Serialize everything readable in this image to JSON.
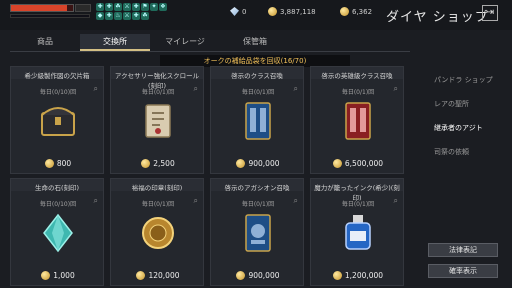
{
  "topbar": {
    "buffs": [
      "✚",
      "✚",
      "☘",
      "⚔",
      "✚",
      "⚑",
      "✦",
      "❖",
      "◆",
      "✚",
      "♨",
      "⚔",
      "✚",
      "☘"
    ],
    "diamond_count": "0",
    "silver_count": "3,887,118",
    "gold_count": "6,362",
    "shop_title": "ダイヤ ショップ",
    "exit_glyph": "⇥"
  },
  "tabs": [
    {
      "label": "商品",
      "active": false
    },
    {
      "label": "交換所",
      "active": true
    },
    {
      "label": "マイレージ",
      "active": false
    },
    {
      "label": "保管箱",
      "active": false
    }
  ],
  "banner": "オークの補給品袋を回収(16/70)",
  "items": [
    {
      "title": "希少級製作図の欠片箱",
      "limit": "毎日(0/10)回",
      "price": "800",
      "icon": "chest-icon"
    },
    {
      "title": "アクセサリー強化スクロール(刻印)",
      "limit": "毎日(0/1)回",
      "price": "2,500",
      "icon": "scroll-icon"
    },
    {
      "title": "啓示のクラス召喚",
      "limit": "毎日(0/1)回",
      "price": "900,000",
      "icon": "card-blue-icon"
    },
    {
      "title": "啓示の英雄級クラス召喚",
      "limit": "毎日(0/1)回",
      "price": "6,500,000",
      "icon": "card-red-icon"
    },
    {
      "title": "生命の石(刻印)",
      "limit": "毎日(0/10)回",
      "price": "1,000",
      "icon": "crystal-icon"
    },
    {
      "title": "裕福の印章(刻印)",
      "limit": "毎日(0/1)回",
      "price": "120,000",
      "icon": "seal-icon"
    },
    {
      "title": "啓示のアガシオン召喚",
      "limit": "毎日(0/1)回",
      "price": "900,000",
      "icon": "card-blue2-icon"
    },
    {
      "title": "魔力が籠ったインク(希少)(刻印)",
      "limit": "毎日(0/1)回",
      "price": "1,200,000",
      "icon": "ink-icon"
    }
  ],
  "sidebar": {
    "items": [
      {
        "label": "パンドラ ショップ",
        "active": false
      },
      {
        "label": "レアの聖所",
        "active": false
      },
      {
        "label": "継承者のアジト",
        "active": true
      },
      {
        "label": "司祭の依頼",
        "active": false
      }
    ],
    "legal_button": "法律表記",
    "probability_button": "確率表示"
  }
}
